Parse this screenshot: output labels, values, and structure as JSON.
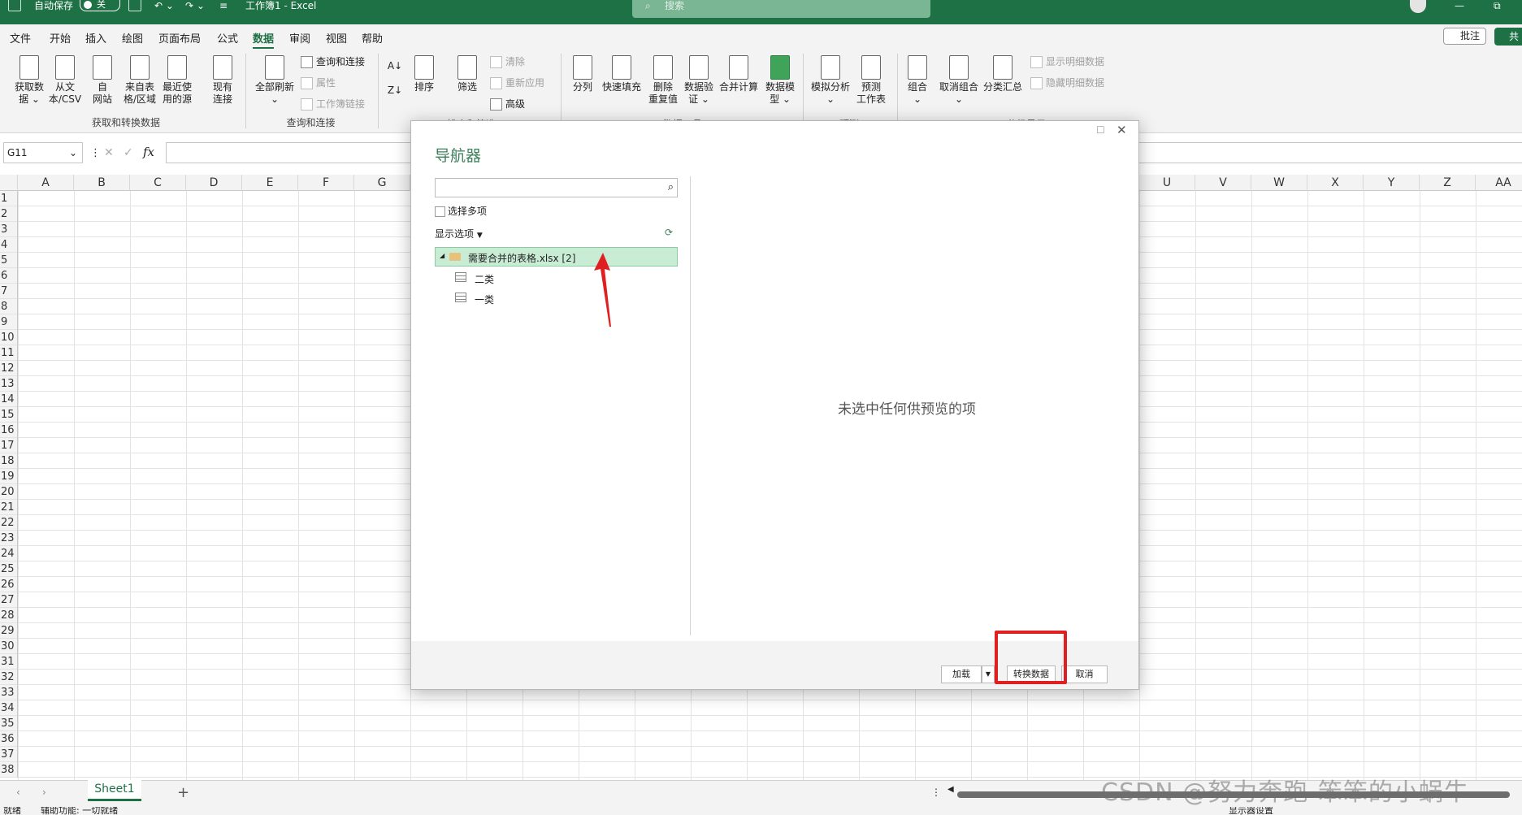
{
  "titlebar": {
    "autosave_label": "自动保存",
    "autosave_state": "关",
    "doc_title": "工作簿1  -  Excel",
    "search_placeholder": "搜索"
  },
  "menu": [
    "文件",
    "开始",
    "插入",
    "绘图",
    "页面布局",
    "公式",
    "数据",
    "审阅",
    "视图",
    "帮助"
  ],
  "menu_active": "数据",
  "comment_label": "批注",
  "share_label": "共",
  "ribbon": {
    "get_data": [
      {
        "label1": "获取数",
        "label2": "据 ⌄"
      },
      {
        "label1": "从文",
        "label2": "本/CSV"
      },
      {
        "label1": "自",
        "label2": "网站"
      },
      {
        "label1": "来自表",
        "label2": "格/区域"
      },
      {
        "label1": "最近使",
        "label2": "用的源"
      },
      {
        "label1": "现有",
        "label2": "连接"
      }
    ],
    "group_get": "获取和转换数据",
    "refresh_all": "全部刷新",
    "queries_connections": "查询和连接",
    "properties": "属性",
    "workbook_links": "工作簿链接",
    "group_query": "查询和连接",
    "sort": "排序",
    "filter": "筛选",
    "clear": "清除",
    "reapply": "重新应用",
    "advanced": "高级",
    "group_sort": "排序和筛选",
    "data_tools": [
      {
        "label1": "分列",
        "label2": ""
      },
      {
        "label1": "快速填充",
        "label2": ""
      },
      {
        "label1": "删除",
        "label2": "重复值"
      },
      {
        "label1": "数据验",
        "label2": "证 ⌄"
      },
      {
        "label1": "合并计算",
        "label2": ""
      },
      {
        "label1": "数据模",
        "label2": "型 ⌄"
      }
    ],
    "group_tools": "数据工具",
    "whatif": "模拟分析",
    "forecast1": "预测",
    "forecast2": "工作表",
    "group_forecast": "预测",
    "group_btn": "组合",
    "ungroup_btn": "取消组合",
    "subtotal": "分类汇总",
    "show_detail": "显示明细数据",
    "hide_detail": "隐藏明细数据",
    "group_outline": "分级显示"
  },
  "namebox": "G11",
  "columns": [
    "A",
    "B",
    "C",
    "D",
    "E",
    "F",
    "G",
    "",
    "",
    "",
    "",
    "",
    "",
    "",
    "",
    "",
    "",
    "",
    "",
    "",
    "U",
    "V",
    "W",
    "X",
    "Y",
    "Z",
    "AA"
  ],
  "rows": [
    "1",
    "2",
    "3",
    "4",
    "5",
    "6",
    "7",
    "8",
    "9",
    "10",
    "11",
    "12",
    "13",
    "14",
    "15",
    "16",
    "17",
    "18",
    "19",
    "20",
    "21",
    "22",
    "23",
    "24",
    "25",
    "26",
    "27",
    "28",
    "29",
    "30",
    "31",
    "32",
    "33",
    "34",
    "35",
    "36",
    "37",
    "38"
  ],
  "sheet_tab": "Sheet1",
  "status": {
    "ready": "就绪",
    "accessibility": "辅助功能: 一切就绪",
    "display_settings": "显示器设置"
  },
  "dialog": {
    "title": "导航器",
    "select_multiple": "选择多项",
    "display_options": "显示选项",
    "file_node": "需要合并的表格.xlsx [2]",
    "sheets": [
      "二类",
      "一类"
    ],
    "empty_preview": "未选中任何供预览的项",
    "load": "加载",
    "transform": "转换数据",
    "cancel": "取消"
  },
  "watermark": "CSDN @努力奔跑-笨笨的小蜗牛",
  "colors": {
    "excel_green": "#1e7145",
    "highlight_red": "#e02020",
    "tree_select": "#c9ecd5"
  }
}
